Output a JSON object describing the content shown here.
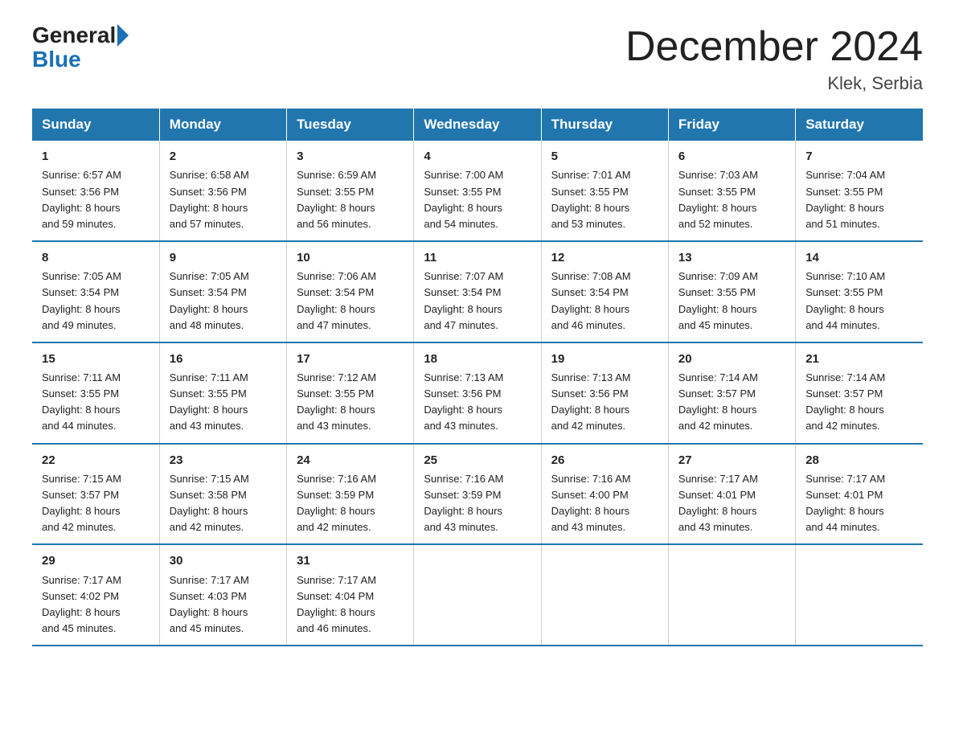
{
  "header": {
    "logo_general": "General",
    "logo_blue": "Blue",
    "main_title": "December 2024",
    "subtitle": "Klek, Serbia"
  },
  "days_of_week": [
    "Sunday",
    "Monday",
    "Tuesday",
    "Wednesday",
    "Thursday",
    "Friday",
    "Saturday"
  ],
  "weeks": [
    [
      {
        "day": "1",
        "info": "Sunrise: 6:57 AM\nSunset: 3:56 PM\nDaylight: 8 hours\nand 59 minutes."
      },
      {
        "day": "2",
        "info": "Sunrise: 6:58 AM\nSunset: 3:56 PM\nDaylight: 8 hours\nand 57 minutes."
      },
      {
        "day": "3",
        "info": "Sunrise: 6:59 AM\nSunset: 3:55 PM\nDaylight: 8 hours\nand 56 minutes."
      },
      {
        "day": "4",
        "info": "Sunrise: 7:00 AM\nSunset: 3:55 PM\nDaylight: 8 hours\nand 54 minutes."
      },
      {
        "day": "5",
        "info": "Sunrise: 7:01 AM\nSunset: 3:55 PM\nDaylight: 8 hours\nand 53 minutes."
      },
      {
        "day": "6",
        "info": "Sunrise: 7:03 AM\nSunset: 3:55 PM\nDaylight: 8 hours\nand 52 minutes."
      },
      {
        "day": "7",
        "info": "Sunrise: 7:04 AM\nSunset: 3:55 PM\nDaylight: 8 hours\nand 51 minutes."
      }
    ],
    [
      {
        "day": "8",
        "info": "Sunrise: 7:05 AM\nSunset: 3:54 PM\nDaylight: 8 hours\nand 49 minutes."
      },
      {
        "day": "9",
        "info": "Sunrise: 7:05 AM\nSunset: 3:54 PM\nDaylight: 8 hours\nand 48 minutes."
      },
      {
        "day": "10",
        "info": "Sunrise: 7:06 AM\nSunset: 3:54 PM\nDaylight: 8 hours\nand 47 minutes."
      },
      {
        "day": "11",
        "info": "Sunrise: 7:07 AM\nSunset: 3:54 PM\nDaylight: 8 hours\nand 47 minutes."
      },
      {
        "day": "12",
        "info": "Sunrise: 7:08 AM\nSunset: 3:54 PM\nDaylight: 8 hours\nand 46 minutes."
      },
      {
        "day": "13",
        "info": "Sunrise: 7:09 AM\nSunset: 3:55 PM\nDaylight: 8 hours\nand 45 minutes."
      },
      {
        "day": "14",
        "info": "Sunrise: 7:10 AM\nSunset: 3:55 PM\nDaylight: 8 hours\nand 44 minutes."
      }
    ],
    [
      {
        "day": "15",
        "info": "Sunrise: 7:11 AM\nSunset: 3:55 PM\nDaylight: 8 hours\nand 44 minutes."
      },
      {
        "day": "16",
        "info": "Sunrise: 7:11 AM\nSunset: 3:55 PM\nDaylight: 8 hours\nand 43 minutes."
      },
      {
        "day": "17",
        "info": "Sunrise: 7:12 AM\nSunset: 3:55 PM\nDaylight: 8 hours\nand 43 minutes."
      },
      {
        "day": "18",
        "info": "Sunrise: 7:13 AM\nSunset: 3:56 PM\nDaylight: 8 hours\nand 43 minutes."
      },
      {
        "day": "19",
        "info": "Sunrise: 7:13 AM\nSunset: 3:56 PM\nDaylight: 8 hours\nand 42 minutes."
      },
      {
        "day": "20",
        "info": "Sunrise: 7:14 AM\nSunset: 3:57 PM\nDaylight: 8 hours\nand 42 minutes."
      },
      {
        "day": "21",
        "info": "Sunrise: 7:14 AM\nSunset: 3:57 PM\nDaylight: 8 hours\nand 42 minutes."
      }
    ],
    [
      {
        "day": "22",
        "info": "Sunrise: 7:15 AM\nSunset: 3:57 PM\nDaylight: 8 hours\nand 42 minutes."
      },
      {
        "day": "23",
        "info": "Sunrise: 7:15 AM\nSunset: 3:58 PM\nDaylight: 8 hours\nand 42 minutes."
      },
      {
        "day": "24",
        "info": "Sunrise: 7:16 AM\nSunset: 3:59 PM\nDaylight: 8 hours\nand 42 minutes."
      },
      {
        "day": "25",
        "info": "Sunrise: 7:16 AM\nSunset: 3:59 PM\nDaylight: 8 hours\nand 43 minutes."
      },
      {
        "day": "26",
        "info": "Sunrise: 7:16 AM\nSunset: 4:00 PM\nDaylight: 8 hours\nand 43 minutes."
      },
      {
        "day": "27",
        "info": "Sunrise: 7:17 AM\nSunset: 4:01 PM\nDaylight: 8 hours\nand 43 minutes."
      },
      {
        "day": "28",
        "info": "Sunrise: 7:17 AM\nSunset: 4:01 PM\nDaylight: 8 hours\nand 44 minutes."
      }
    ],
    [
      {
        "day": "29",
        "info": "Sunrise: 7:17 AM\nSunset: 4:02 PM\nDaylight: 8 hours\nand 45 minutes."
      },
      {
        "day": "30",
        "info": "Sunrise: 7:17 AM\nSunset: 4:03 PM\nDaylight: 8 hours\nand 45 minutes."
      },
      {
        "day": "31",
        "info": "Sunrise: 7:17 AM\nSunset: 4:04 PM\nDaylight: 8 hours\nand 46 minutes."
      },
      {
        "day": "",
        "info": ""
      },
      {
        "day": "",
        "info": ""
      },
      {
        "day": "",
        "info": ""
      },
      {
        "day": "",
        "info": ""
      }
    ]
  ]
}
